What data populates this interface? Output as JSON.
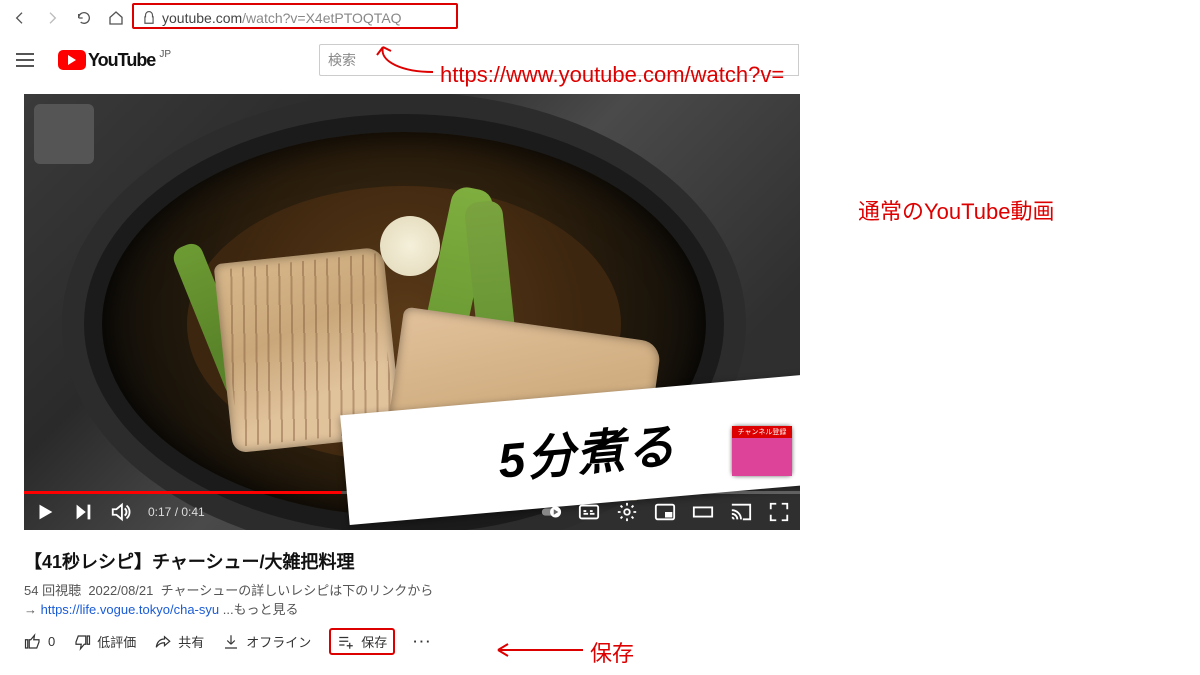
{
  "browser": {
    "url_display_prefix": "youtube.com",
    "url_display_path": "/watch?v=X4etPTOQTAQ"
  },
  "youtube_header": {
    "brand": "YouTube",
    "region": "JP",
    "search_placeholder": "検索"
  },
  "player": {
    "overlay_text": "5分煮る",
    "endcard_label": "チャンネル登録",
    "time_current": "0:17",
    "time_total": "0:41"
  },
  "video": {
    "title": "【41秒レシピ】チャーシュー/大雑把料理",
    "views": "54 回視聴",
    "date": "2022/08/21",
    "desc_lead": "チャーシューの詳しいレシピは下のリンクから",
    "desc_arrow": "→ ",
    "desc_link": "https://life.vogue.tokyo/cha-syu",
    "desc_more": " ...もっと見る"
  },
  "actions": {
    "like_count": "0",
    "dislike": "低評価",
    "share": "共有",
    "offline": "オフライン",
    "save": "保存"
  },
  "annotations": {
    "url_hint": "https://www.youtube.com/watch?v=",
    "normal_video": "通常のYouTube動画",
    "save_hint": "保存"
  }
}
